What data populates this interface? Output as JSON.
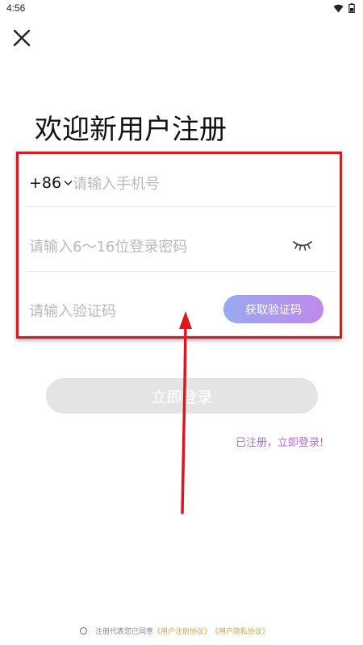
{
  "status_bar": {
    "time": "4:56"
  },
  "page": {
    "title": "欢迎新用户注册"
  },
  "form": {
    "country_code": "+86",
    "phone_placeholder": "请输入手机号",
    "password_placeholder": "请输入6～16位登录密码",
    "code_placeholder": "请输入验证码",
    "get_code_label": "获取验证码"
  },
  "login_button": "立即登录",
  "registered_link": "已注册，立即登录!",
  "agreement": {
    "prefix": "注册代表您已同意",
    "user_agreement": "《用户注册协议》",
    "privacy_agreement": "《用户隐私协议》"
  },
  "colors": {
    "accent_gradient_start": "#99a9f0",
    "accent_gradient_end": "#c089ea",
    "link_purple": "#b56ad4",
    "agreement_link": "#d1a34a",
    "annotation_red": "#e2141c"
  },
  "icons": [
    "close-icon",
    "wifi-icon",
    "battery-icon",
    "chevron-down-icon",
    "eye-closed-icon"
  ]
}
